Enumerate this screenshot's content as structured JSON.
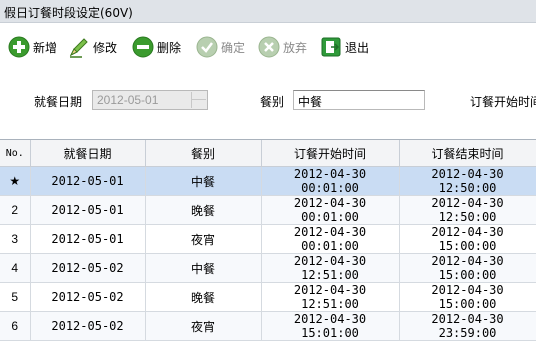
{
  "window": {
    "title": "假日订餐时段设定(60V)"
  },
  "toolbar": {
    "add_label": "新增",
    "edit_label": "修改",
    "delete_label": "删除",
    "confirm_label": "确定",
    "abandon_label": "放弃",
    "exit_label": "退出"
  },
  "form": {
    "date_label": "就餐日期",
    "date_value": "2012-05-01",
    "meal_label": "餐别",
    "meal_value": "中餐",
    "start_time_label": "订餐开始时间"
  },
  "table": {
    "headers": [
      "No.",
      "就餐日期",
      "餐别",
      "订餐开始时间",
      "订餐结束时间"
    ],
    "rows": [
      {
        "no": "★",
        "date": "2012-05-01",
        "meal": "中餐",
        "start": "2012-04-30 00:01:00",
        "end": "2012-04-30 12:50:00"
      },
      {
        "no": "2",
        "date": "2012-05-01",
        "meal": "晚餐",
        "start": "2012-04-30 00:01:00",
        "end": "2012-04-30 12:50:00"
      },
      {
        "no": "3",
        "date": "2012-05-01",
        "meal": "夜宵",
        "start": "2012-04-30 00:01:00",
        "end": "2012-04-30 15:00:00"
      },
      {
        "no": "4",
        "date": "2012-05-02",
        "meal": "中餐",
        "start": "2012-04-30 12:51:00",
        "end": "2012-04-30 15:00:00"
      },
      {
        "no": "5",
        "date": "2012-05-02",
        "meal": "晚餐",
        "start": "2012-04-30 12:51:00",
        "end": "2012-04-30 15:00:00"
      },
      {
        "no": "6",
        "date": "2012-05-02",
        "meal": "夜宵",
        "start": "2012-04-30 15:01:00",
        "end": "2012-04-30 23:59:00"
      }
    ]
  }
}
